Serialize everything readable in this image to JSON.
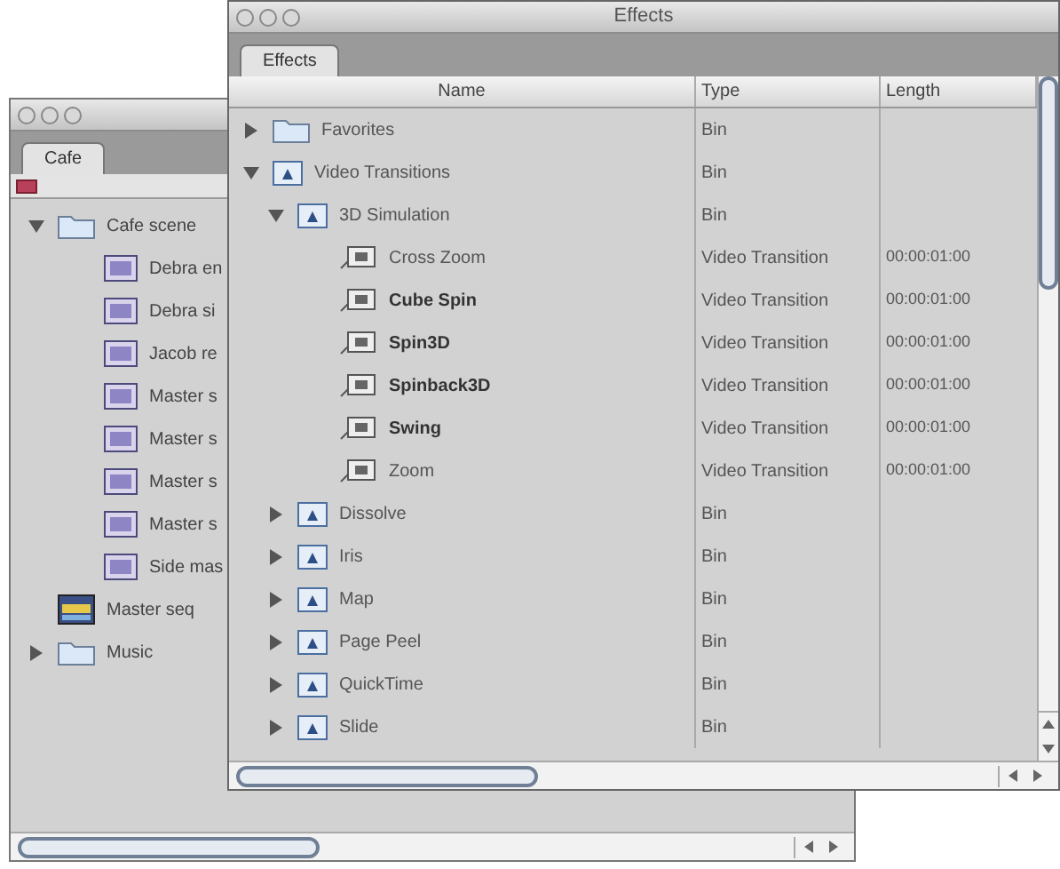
{
  "back_window": {
    "tabs": [
      {
        "label": "Cafe",
        "selected": true
      }
    ],
    "items": [
      {
        "name": "Cafe scene",
        "kind": "folder",
        "expanded": true,
        "children": [
          {
            "name": "Debra en",
            "kind": "clip"
          },
          {
            "name": "Debra si",
            "kind": "clip"
          },
          {
            "name": "Jacob re",
            "kind": "clip"
          },
          {
            "name": "Master s",
            "kind": "clip"
          },
          {
            "name": "Master s",
            "kind": "clip"
          },
          {
            "name": "Master s",
            "kind": "clip"
          },
          {
            "name": "Master s",
            "kind": "clip"
          },
          {
            "name": "Side mas",
            "kind": "clip"
          }
        ]
      },
      {
        "name": "Master seq",
        "kind": "sequence"
      },
      {
        "name": "Music",
        "kind": "folder",
        "expanded": false
      }
    ]
  },
  "front_window": {
    "title": "Effects",
    "tabs": [
      {
        "label": "Effects",
        "selected": true
      }
    ],
    "columns": [
      "Name",
      "Type",
      "Length"
    ],
    "items": [
      {
        "name": "Favorites",
        "kind": "folder",
        "expanded": false,
        "type": "Bin"
      },
      {
        "name": "Video Transitions",
        "kind": "bin",
        "expanded": true,
        "type": "Bin",
        "children": [
          {
            "name": "3D Simulation",
            "kind": "bin",
            "expanded": true,
            "type": "Bin",
            "children": [
              {
                "name": "Cross Zoom",
                "kind": "transition",
                "bold": false,
                "type": "Video Transition",
                "length": "00:00:01:00"
              },
              {
                "name": "Cube Spin",
                "kind": "transition",
                "bold": true,
                "type": "Video Transition",
                "length": "00:00:01:00"
              },
              {
                "name": "Spin3D",
                "kind": "transition",
                "bold": true,
                "type": "Video Transition",
                "length": "00:00:01:00"
              },
              {
                "name": "Spinback3D",
                "kind": "transition",
                "bold": true,
                "type": "Video Transition",
                "length": "00:00:01:00"
              },
              {
                "name": "Swing",
                "kind": "transition",
                "bold": true,
                "type": "Video Transition",
                "length": "00:00:01:00"
              },
              {
                "name": "Zoom",
                "kind": "transition",
                "bold": false,
                "type": "Video Transition",
                "length": "00:00:01:00"
              }
            ]
          },
          {
            "name": "Dissolve",
            "kind": "bin",
            "expanded": false,
            "type": "Bin"
          },
          {
            "name": "Iris",
            "kind": "bin",
            "expanded": false,
            "type": "Bin"
          },
          {
            "name": "Map",
            "kind": "bin",
            "expanded": false,
            "type": "Bin"
          },
          {
            "name": "Page Peel",
            "kind": "bin",
            "expanded": false,
            "type": "Bin"
          },
          {
            "name": "QuickTime",
            "kind": "bin",
            "expanded": false,
            "type": "Bin"
          },
          {
            "name": "Slide",
            "kind": "bin",
            "expanded": false,
            "type": "Bin"
          }
        ]
      }
    ]
  }
}
